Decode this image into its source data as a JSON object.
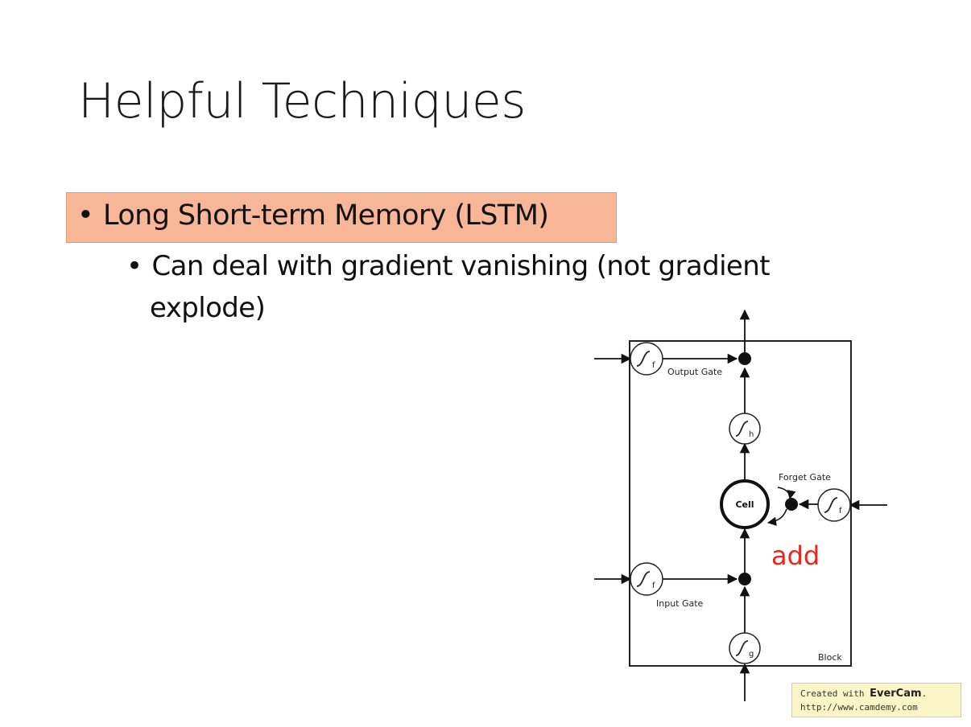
{
  "slide": {
    "title": "Helpful Techniques",
    "bullets": [
      {
        "text": "Long Short-term Memory (LSTM)",
        "highlighted": true
      },
      {
        "text_line1": "Can deal with gradient vanishing (not gradient",
        "text_line2": "explode)"
      }
    ],
    "bullet_glyph": "•"
  },
  "diagram": {
    "labels": {
      "output_gate": "Output Gate",
      "forget_gate": "Forget Gate",
      "input_gate": "Input Gate",
      "cell": "Cell",
      "block": "Block",
      "annotation": "add"
    },
    "unit_subscripts": {
      "output": "f",
      "h": "h",
      "forget": "f",
      "input": "f",
      "g": "g"
    },
    "annotation_color": "#e8271c"
  },
  "watermark": {
    "prefix": "Created with ",
    "brand": "EverCam",
    "suffix": ".",
    "url": "http://www.camdemy.com"
  }
}
